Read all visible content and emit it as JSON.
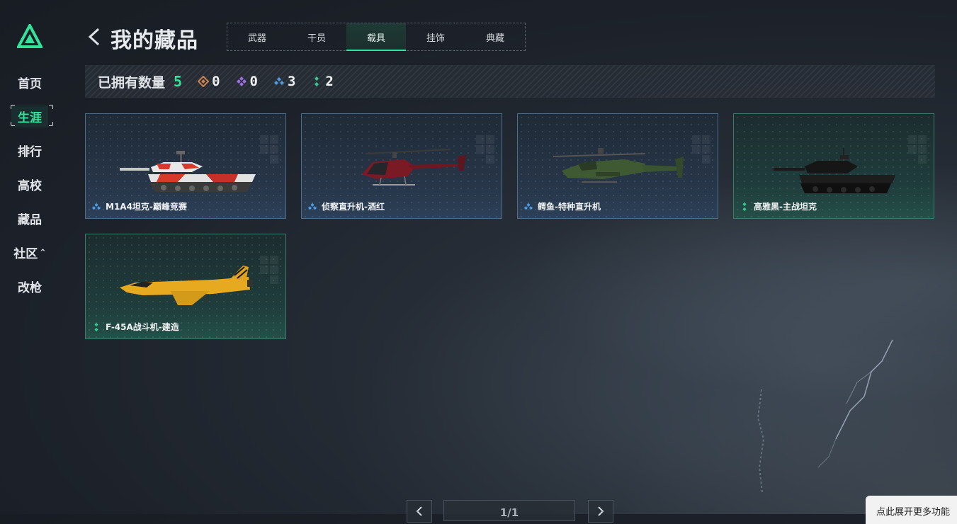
{
  "sidebar": {
    "items": [
      {
        "label": "首页"
      },
      {
        "label": "生涯",
        "active": true
      },
      {
        "label": "排行"
      },
      {
        "label": "高校"
      },
      {
        "label": "藏品"
      },
      {
        "label": "社区",
        "caret": "^"
      },
      {
        "label": "改枪"
      }
    ]
  },
  "header": {
    "title": "我的藏品",
    "tabs": [
      {
        "label": "武器"
      },
      {
        "label": "干员"
      },
      {
        "label": "载具",
        "active": true
      },
      {
        "label": "挂饰"
      },
      {
        "label": "典藏"
      }
    ]
  },
  "summary": {
    "owned_label": "已拥有数量",
    "owned_total": "5",
    "rarity_counts": [
      {
        "icon": "orange-diamond-icon",
        "color": "#c9814f",
        "count": "0"
      },
      {
        "icon": "purple-diamond-icon",
        "color": "#9b6ee0",
        "count": "0"
      },
      {
        "icon": "blue-diamond-icon",
        "color": "#4d9be0",
        "count": "3"
      },
      {
        "icon": "green-diamond-icon",
        "color": "#33c98a",
        "count": "2"
      }
    ]
  },
  "cards": [
    {
      "name": "M1A4坦克-巅峰竞赛",
      "rarity": "blue",
      "vehicle": "tank-red-white"
    },
    {
      "name": "侦察直升机-酒红",
      "rarity": "blue",
      "vehicle": "scout-helicopter-red"
    },
    {
      "name": "鳄鱼-特种直升机",
      "rarity": "blue",
      "vehicle": "attack-helicopter-green"
    },
    {
      "name": "高雅黑-主战坦克",
      "rarity": "green",
      "vehicle": "tank-black"
    },
    {
      "name": "F-45A战斗机-建造",
      "rarity": "green",
      "vehicle": "fighter-jet-yellow"
    }
  ],
  "pagination": {
    "page": "1/1"
  },
  "expand_button": {
    "label": "点此展开更多功能"
  },
  "colors": {
    "accent": "#33e39a",
    "blue_rarity": "#4d9be0",
    "green_rarity": "#33c98a"
  }
}
